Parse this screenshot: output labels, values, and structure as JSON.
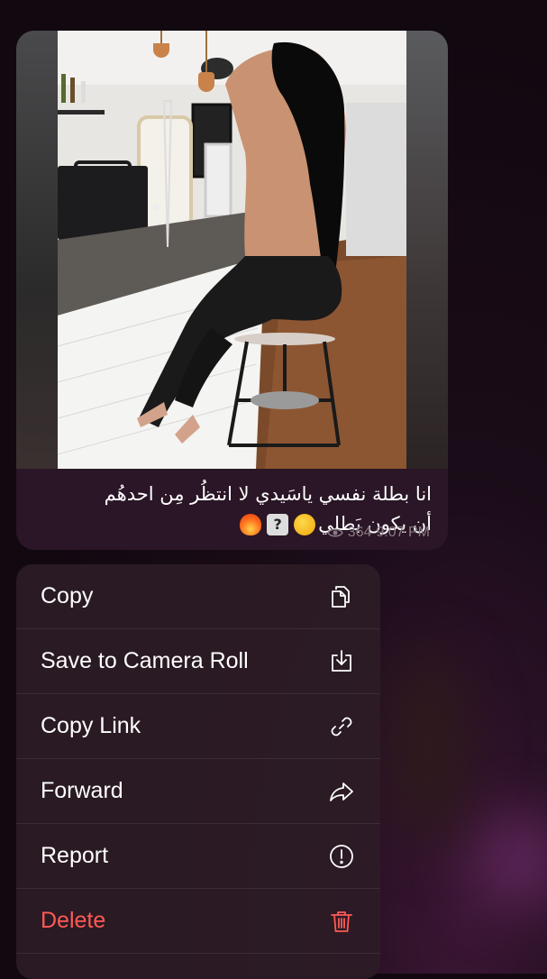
{
  "message": {
    "caption_line1": "انا بطلة نفسي ياسَيدي لا انتظُر مِن احدهُم",
    "caption_line2": "أن يكون بَطلي",
    "emoji": [
      "face-icon",
      "question-box-icon",
      "fire-icon"
    ],
    "views": "364",
    "time": "9:07 PM"
  },
  "menu": {
    "items": [
      {
        "label": "Copy",
        "icon": "copy-icon"
      },
      {
        "label": "Save to Camera Roll",
        "icon": "save-download-icon"
      },
      {
        "label": "Copy Link",
        "icon": "link-icon"
      },
      {
        "label": "Forward",
        "icon": "forward-arrow-icon"
      },
      {
        "label": "Report",
        "icon": "report-exclamation-icon"
      },
      {
        "label": "Delete",
        "icon": "trash-icon"
      }
    ]
  },
  "colors": {
    "background": "#120810",
    "bubble": "#2a1626",
    "menu": "#2c1c26",
    "delete": "#ff5a55",
    "meta": "#8a7a86"
  }
}
